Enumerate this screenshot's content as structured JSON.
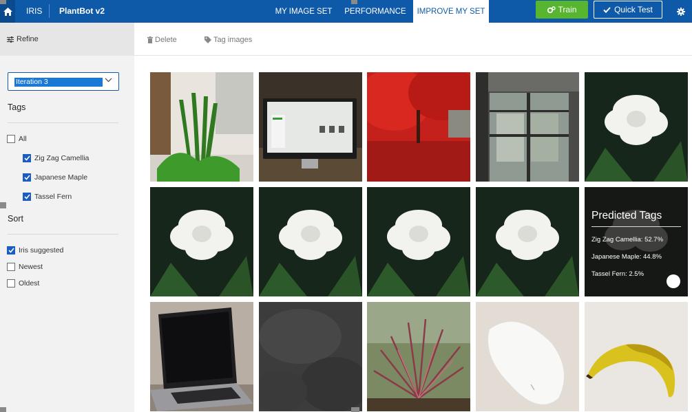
{
  "header": {
    "brand": "IRIS",
    "project": "PlantBot v2",
    "tabs": [
      {
        "label": "MY IMAGE SET",
        "active": false
      },
      {
        "label": "PERFORMANCE",
        "active": false
      },
      {
        "label": "IMPROVE MY SET",
        "active": true
      }
    ],
    "train_label": "Train",
    "quick_test_label": "Quick Test",
    "icons": {
      "home": "home-icon",
      "train": "gears-icon",
      "quick_test": "check-icon",
      "settings": "gear-icon"
    },
    "colors": {
      "bar": "#0f5aa8",
      "train_button": "#57b52f"
    }
  },
  "sidebar": {
    "refine_label": "Refine",
    "iteration_selected": "Iteration 3",
    "tags_heading": "Tags",
    "tags": [
      {
        "label": "All",
        "checked": false
      },
      {
        "label": "Zig Zag Camellia",
        "checked": true
      },
      {
        "label": "Japanese Maple",
        "checked": true
      },
      {
        "label": "Tassel Fern",
        "checked": true
      }
    ],
    "sort_heading": "Sort",
    "sort": [
      {
        "label": "Iris suggested",
        "checked": true
      },
      {
        "label": "Newest",
        "checked": false
      },
      {
        "label": "Oldest",
        "checked": false
      }
    ]
  },
  "actions": {
    "delete_label": "Delete",
    "tag_label": "Tag images"
  },
  "grid": {
    "images": [
      "plant-in-pot",
      "computer-monitor",
      "red-maple-tree",
      "window",
      "white-gardenia",
      "white-gardenia",
      "white-gardenia",
      "white-gardenia",
      "white-gardenia",
      "predicted-card",
      "laptop",
      "dark-texture",
      "spiky-plant",
      "computer-mouse",
      "banana"
    ]
  },
  "predicted": {
    "title": "Predicted Tags",
    "lines": [
      "Zig Zag Camellia: 52.7%",
      "Japanese Maple: 44.8%",
      "Tassel Fern: 2.5%"
    ]
  }
}
